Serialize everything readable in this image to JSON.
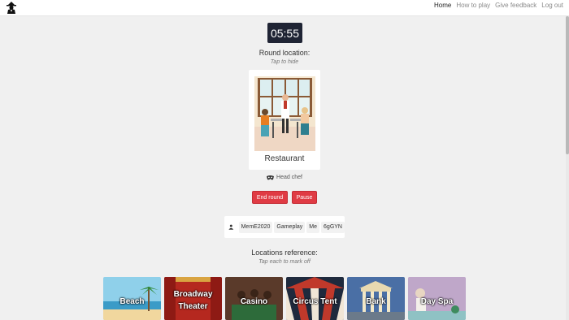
{
  "nav": {
    "links": [
      "Home",
      "How to play",
      "Give feedback",
      "Log out"
    ],
    "active": "Home"
  },
  "timer": "05:55",
  "round": {
    "label": "Round location:",
    "hint": "Tap to hide",
    "location": "Restaurant",
    "role": "Head chef"
  },
  "buttons": {
    "end_round": "End round",
    "pause": "Pause"
  },
  "players": [
    "MemE2020",
    "Gameplay",
    "Me",
    "6gGYN"
  ],
  "reference": {
    "label": "Locations reference:",
    "hint": "Tap each to mark off",
    "tiles": [
      "Beach",
      "Broadway Theater",
      "Casino",
      "Circus Tent",
      "Bank",
      "Day Spa"
    ]
  },
  "colors": {
    "timer_bg": "#1f2434",
    "button": "#e03b44"
  },
  "icons": {
    "logo": "spy-icon",
    "role": "mask-icon",
    "players": "person-icon"
  }
}
